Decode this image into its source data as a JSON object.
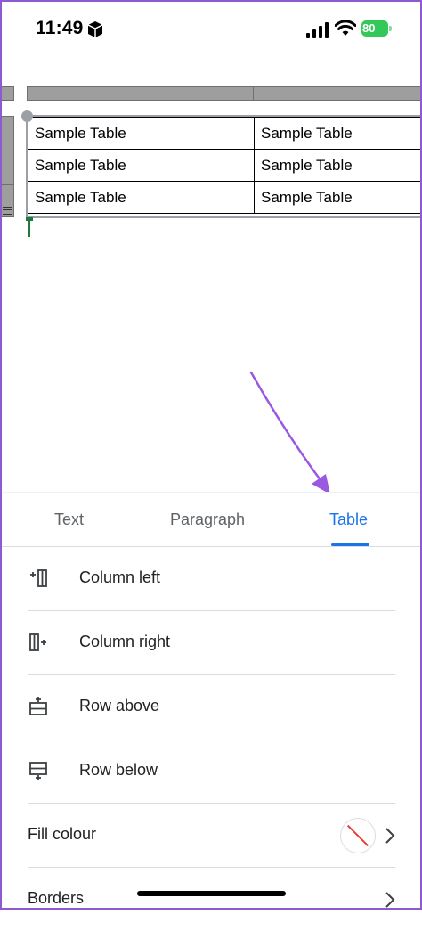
{
  "status_bar": {
    "time": "11:49",
    "battery_level": "80"
  },
  "document": {
    "table": {
      "rows": [
        [
          "Sample Table",
          "Sample Table"
        ],
        [
          "Sample Table",
          "Sample Table"
        ],
        [
          "Sample Table",
          "Sample Table"
        ]
      ]
    }
  },
  "format_panel": {
    "tabs": [
      {
        "label": "Text",
        "active": false
      },
      {
        "label": "Paragraph",
        "active": false
      },
      {
        "label": "Table",
        "active": true
      }
    ],
    "items": [
      {
        "label": "Column left",
        "icon": "column-left-icon"
      },
      {
        "label": "Column right",
        "icon": "column-right-icon"
      },
      {
        "label": "Row above",
        "icon": "row-above-icon"
      },
      {
        "label": "Row below",
        "icon": "row-below-icon"
      },
      {
        "label": "Fill colour",
        "icon": "fill-swatch"
      },
      {
        "label": "Borders",
        "icon": "chevron-right-icon"
      }
    ]
  },
  "colors": {
    "accent": "#1a73e8",
    "annotation_arrow": "#9b59e0",
    "cursor": "#1b7a3e",
    "battery": "#34c759"
  }
}
